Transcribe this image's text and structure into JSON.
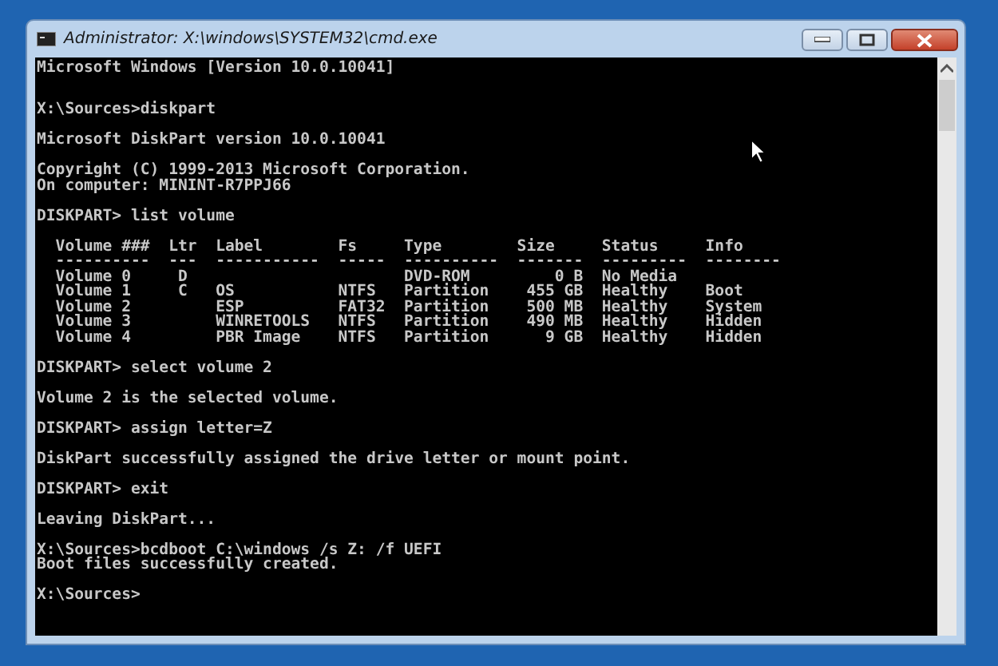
{
  "window": {
    "title": "Administrator: X:\\windows\\SYSTEM32\\cmd.exe"
  },
  "console": {
    "blocks": [
      [
        "Microsoft Windows [Version 10.0.10041]"
      ],
      [
        "X:\\Sources>diskpart"
      ],
      [
        "Microsoft DiskPart version 10.0.10041"
      ],
      [
        "Copyright (C) 1999-2013 Microsoft Corporation.",
        "On computer: MININT-R7PPJ66"
      ],
      [
        "DISKPART> list volume"
      ],
      [
        "  Volume ###  Ltr  Label        Fs     Type        Size     Status     Info",
        "  ----------  ---  -----------  -----  ----------  -------  ---------  --------",
        "  Volume 0     D                       DVD-ROM         0 B  No Media",
        "  Volume 1     C   OS           NTFS   Partition    455 GB  Healthy    Boot",
        "  Volume 2         ESP          FAT32  Partition    500 MB  Healthy    System",
        "  Volume 3         WINRETOOLS   NTFS   Partition    490 MB  Healthy    Hidden",
        "  Volume 4         PBR Image    NTFS   Partition      9 GB  Healthy    Hidden"
      ],
      [
        "DISKPART> select volume 2"
      ],
      [
        "Volume 2 is the selected volume."
      ],
      [
        "DISKPART> assign letter=Z"
      ],
      [
        "DiskPart successfully assigned the drive letter or mount point."
      ],
      [
        "DISKPART> exit"
      ],
      [
        "Leaving DiskPart..."
      ],
      [
        "X:\\Sources>bcdboot C:\\windows /s Z: /f UEFI",
        "Boot files successfully created."
      ],
      [
        "X:\\Sources>"
      ]
    ]
  }
}
